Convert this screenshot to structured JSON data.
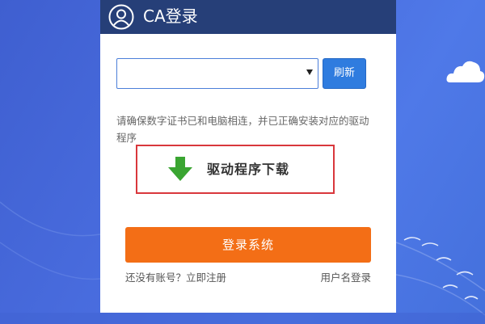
{
  "header": {
    "title": "CA登录",
    "user_icon": "user-circle-icon",
    "background": "#263f78"
  },
  "certificate": {
    "selected_value": "",
    "caret_icon": "caret-down-icon"
  },
  "refresh_button": {
    "label": "刷新",
    "color": "#2f7cdf"
  },
  "hint": {
    "text": "请确保数字证书已和电脑相连，并已正确安装对应的驱动程序"
  },
  "driver_download": {
    "label": "驱动程序下载",
    "icon": "download-arrow-icon",
    "highlight_color": "#d9373c"
  },
  "login_button": {
    "label": "登录系统",
    "color": "#f36e16"
  },
  "footer": {
    "register_link": "还没有账号？立即注册",
    "username_login_link": "用户名登录"
  },
  "background": {
    "color": "#4a6ee0",
    "decoration": "cloud-icon"
  }
}
